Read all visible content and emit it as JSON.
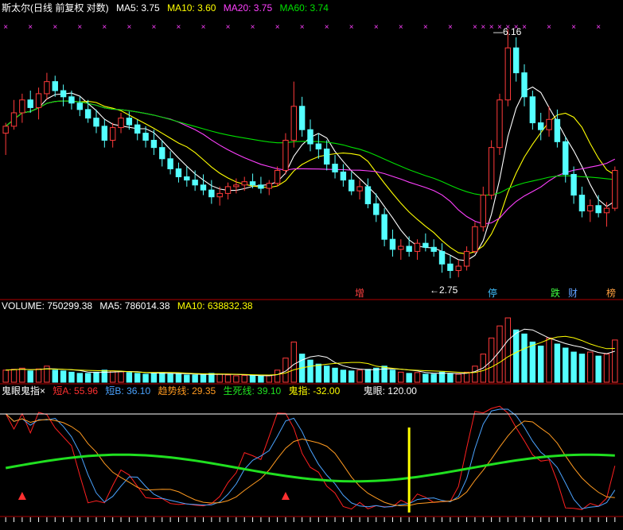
{
  "header": {
    "title": "斯太尔(日线 前复权 对数)",
    "ma5": "MA5: 3.75",
    "ma10": "MA10: 3.60",
    "ma20": "MA20: 3.75",
    "ma60": "MA60: 3.74"
  },
  "volume_header": {
    "label": "VOLUME: 750299.38",
    "ma5": "MA5: 786014.38",
    "ma10": "MA10: 638832.38"
  },
  "indicator_header": {
    "name": "鬼眼鬼指",
    "close_mark": "×",
    "a": "短A: 55.96",
    "b": "短B: 36.10",
    "trend": "趋势线: 29.35",
    "life": "生死线: 39.10",
    "finger": "鬼指: -32.00",
    "eye": "鬼眼: 120.00"
  },
  "annotations": {
    "high": "6.16",
    "low": "2.75"
  },
  "event_tags": [
    "增",
    "停",
    "跌",
    "财",
    "榜"
  ],
  "colors": {
    "up": "#ff3a3a",
    "down": "#54ffff",
    "ma5": "#ffffff",
    "ma10": "#ffff00",
    "ma20": "#ff40ff",
    "ma60": "#00e000",
    "short_a": "#ff2020",
    "short_b": "#4aa3ff",
    "trend": "#ff9a20",
    "life": "#20e020",
    "finger": "#ffffff",
    "eye": "#ffff00"
  },
  "chart_data": {
    "type": "candlestick",
    "price_scale": "log",
    "ylim": [
      2.6,
      6.4
    ],
    "price_marks": {
      "high": 6.16,
      "low": 2.75
    },
    "candles": [
      [
        4.4,
        4.55,
        4.1,
        4.5
      ],
      [
        4.5,
        4.9,
        4.45,
        4.7
      ],
      [
        4.7,
        5.0,
        4.55,
        4.9
      ],
      [
        4.9,
        5.05,
        4.7,
        4.78
      ],
      [
        4.78,
        5.1,
        4.6,
        5.0
      ],
      [
        5.0,
        5.35,
        4.9,
        5.2
      ],
      [
        5.2,
        5.3,
        4.95,
        5.05
      ],
      [
        5.05,
        5.15,
        4.8,
        4.95
      ],
      [
        4.95,
        5.05,
        4.75,
        4.85
      ],
      [
        4.85,
        4.95,
        4.65,
        4.75
      ],
      [
        4.75,
        4.9,
        4.55,
        4.62
      ],
      [
        4.62,
        4.75,
        4.4,
        4.5
      ],
      [
        4.5,
        4.6,
        4.2,
        4.3
      ],
      [
        4.3,
        4.55,
        4.2,
        4.48
      ],
      [
        4.48,
        4.7,
        4.4,
        4.62
      ],
      [
        4.62,
        4.72,
        4.45,
        4.52
      ],
      [
        4.52,
        4.6,
        4.3,
        4.4
      ],
      [
        4.4,
        4.5,
        4.2,
        4.3
      ],
      [
        4.3,
        4.45,
        4.1,
        4.2
      ],
      [
        4.2,
        4.3,
        3.95,
        4.05
      ],
      [
        4.05,
        4.15,
        3.85,
        3.92
      ],
      [
        3.92,
        4.0,
        3.75,
        3.82
      ],
      [
        3.82,
        3.95,
        3.7,
        3.78
      ],
      [
        3.78,
        3.9,
        3.65,
        3.72
      ],
      [
        3.72,
        3.85,
        3.6,
        3.66
      ],
      [
        3.66,
        3.78,
        3.5,
        3.58
      ],
      [
        3.58,
        3.7,
        3.48,
        3.62
      ],
      [
        3.62,
        3.75,
        3.55,
        3.7
      ],
      [
        3.7,
        3.8,
        3.62,
        3.72
      ],
      [
        3.72,
        3.82,
        3.65,
        3.76
      ],
      [
        3.76,
        3.86,
        3.68,
        3.72
      ],
      [
        3.72,
        3.82,
        3.62,
        3.68
      ],
      [
        3.68,
        3.78,
        3.6,
        3.74
      ],
      [
        3.74,
        3.95,
        3.7,
        3.9
      ],
      [
        3.9,
        4.4,
        3.85,
        4.3
      ],
      [
        4.3,
        5.2,
        4.2,
        4.8
      ],
      [
        4.8,
        4.95,
        4.35,
        4.45
      ],
      [
        4.45,
        4.6,
        4.15,
        4.25
      ],
      [
        4.25,
        4.4,
        4.05,
        4.18
      ],
      [
        4.18,
        4.3,
        3.9,
        3.98
      ],
      [
        3.98,
        4.1,
        3.8,
        3.88
      ],
      [
        3.88,
        3.98,
        3.7,
        3.78
      ],
      [
        3.78,
        3.88,
        3.6,
        3.65
      ],
      [
        3.65,
        3.78,
        3.55,
        3.7
      ],
      [
        3.7,
        3.8,
        3.45,
        3.5
      ],
      [
        3.5,
        3.62,
        3.3,
        3.38
      ],
      [
        3.38,
        3.45,
        3.05,
        3.12
      ],
      [
        3.12,
        3.22,
        2.95,
        3.02
      ],
      [
        3.02,
        3.12,
        2.92,
        3.05
      ],
      [
        3.05,
        3.15,
        2.95,
        3.0
      ],
      [
        3.0,
        3.12,
        2.92,
        3.08
      ],
      [
        3.08,
        3.18,
        3.0,
        3.04
      ],
      [
        3.04,
        3.12,
        2.95,
        3.0
      ],
      [
        3.0,
        3.08,
        2.8,
        2.88
      ],
      [
        2.88,
        2.96,
        2.75,
        2.82
      ],
      [
        2.82,
        2.92,
        2.76,
        2.86
      ],
      [
        2.86,
        3.05,
        2.82,
        3.0
      ],
      [
        3.0,
        3.3,
        2.98,
        3.25
      ],
      [
        3.25,
        3.7,
        3.2,
        3.6
      ],
      [
        3.6,
        4.3,
        3.55,
        4.2
      ],
      [
        4.2,
        5.0,
        4.1,
        4.9
      ],
      [
        4.9,
        6.16,
        4.8,
        5.8
      ],
      [
        5.8,
        6.0,
        5.2,
        5.35
      ],
      [
        5.35,
        5.5,
        4.8,
        4.95
      ],
      [
        4.95,
        5.05,
        4.45,
        4.55
      ],
      [
        4.55,
        4.7,
        4.3,
        4.45
      ],
      [
        4.45,
        4.8,
        4.35,
        4.6
      ],
      [
        4.6,
        4.75,
        4.2,
        4.28
      ],
      [
        4.28,
        4.35,
        3.75,
        3.85
      ],
      [
        3.85,
        3.95,
        3.5,
        3.6
      ],
      [
        3.6,
        3.7,
        3.35,
        3.42
      ],
      [
        3.42,
        3.55,
        3.3,
        3.48
      ],
      [
        3.48,
        3.6,
        3.35,
        3.4
      ],
      [
        3.4,
        3.52,
        3.25,
        3.45
      ],
      [
        3.45,
        3.95,
        3.42,
        3.9
      ]
    ],
    "volume": [
      [
        0.3,
        1
      ],
      [
        0.32,
        1
      ],
      [
        0.35,
        1
      ],
      [
        0.28,
        0
      ],
      [
        0.33,
        1
      ],
      [
        0.4,
        1
      ],
      [
        0.3,
        0
      ],
      [
        0.28,
        0
      ],
      [
        0.25,
        0
      ],
      [
        0.22,
        0
      ],
      [
        0.22,
        0
      ],
      [
        0.25,
        0
      ],
      [
        0.3,
        0
      ],
      [
        0.28,
        1
      ],
      [
        0.26,
        1
      ],
      [
        0.24,
        0
      ],
      [
        0.22,
        0
      ],
      [
        0.2,
        0
      ],
      [
        0.22,
        0
      ],
      [
        0.24,
        0
      ],
      [
        0.22,
        0
      ],
      [
        0.2,
        0
      ],
      [
        0.18,
        0
      ],
      [
        0.18,
        0
      ],
      [
        0.2,
        0
      ],
      [
        0.22,
        0
      ],
      [
        0.2,
        1
      ],
      [
        0.18,
        1
      ],
      [
        0.16,
        1
      ],
      [
        0.17,
        1
      ],
      [
        0.16,
        0
      ],
      [
        0.15,
        0
      ],
      [
        0.16,
        1
      ],
      [
        0.3,
        1
      ],
      [
        0.6,
        1
      ],
      [
        1.0,
        1
      ],
      [
        0.7,
        0
      ],
      [
        0.55,
        0
      ],
      [
        0.45,
        0
      ],
      [
        0.4,
        0
      ],
      [
        0.35,
        0
      ],
      [
        0.3,
        0
      ],
      [
        0.28,
        0
      ],
      [
        0.3,
        1
      ],
      [
        0.32,
        0
      ],
      [
        0.35,
        0
      ],
      [
        0.4,
        0
      ],
      [
        0.3,
        0
      ],
      [
        0.25,
        1
      ],
      [
        0.22,
        0
      ],
      [
        0.24,
        1
      ],
      [
        0.2,
        0
      ],
      [
        0.2,
        0
      ],
      [
        0.25,
        0
      ],
      [
        0.22,
        0
      ],
      [
        0.2,
        1
      ],
      [
        0.25,
        1
      ],
      [
        0.4,
        1
      ],
      [
        0.7,
        1
      ],
      [
        1.1,
        1
      ],
      [
        1.4,
        1
      ],
      [
        1.6,
        1
      ],
      [
        1.3,
        0
      ],
      [
        1.2,
        0
      ],
      [
        1.0,
        0
      ],
      [
        0.9,
        0
      ],
      [
        1.1,
        1
      ],
      [
        0.95,
        0
      ],
      [
        0.85,
        0
      ],
      [
        0.75,
        0
      ],
      [
        0.7,
        0
      ],
      [
        0.75,
        1
      ],
      [
        0.65,
        0
      ],
      [
        0.7,
        1
      ],
      [
        1.05,
        1
      ]
    ],
    "ma_labels": [
      "MA5",
      "MA10",
      "MA20",
      "MA60"
    ],
    "indicator": {
      "short_a": 55.96,
      "short_b": 36.1,
      "trend": 29.35,
      "life": 39.1,
      "finger": -32.0,
      "eye": 120.0
    }
  }
}
